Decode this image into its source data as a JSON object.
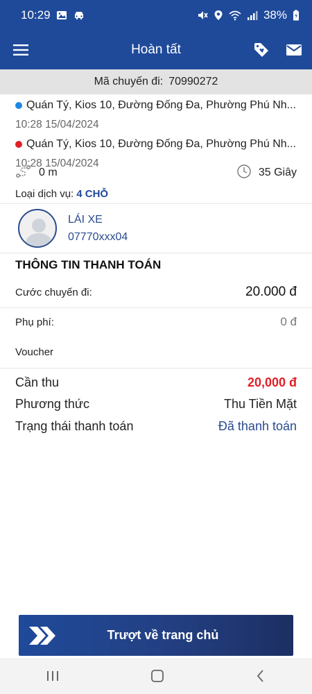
{
  "status_bar": {
    "time": "10:29",
    "battery": "38%",
    "icons_left": [
      "image-icon",
      "car-icon"
    ],
    "icons_right": [
      "mute-icon",
      "location-icon",
      "wifi-icon",
      "signal-icon",
      "battery-icon"
    ]
  },
  "app_bar": {
    "title": "Hoàn tất",
    "menu_icon": "hamburger-menu-icon",
    "actions": [
      "tag-heart-icon",
      "mail-icon"
    ]
  },
  "trip": {
    "id_label": "Mã chuyến đi:",
    "id_value": "70990272",
    "pickup": {
      "address": "Quán Tý, Kios 10, Đường Đống Đa, Phường Phú Nh...",
      "time": "10:28 15/04/2024",
      "color": "#1e88e5"
    },
    "dropoff": {
      "address": "Quán Tý, Kios 10, Đường Đống Đa, Phường Phú Nh...",
      "time": "10:28 15/04/2024",
      "color": "#e21f26"
    },
    "distance": "0 m",
    "duration": "35 Giây",
    "service_label": "Loại dịch vụ:",
    "service_value": "4 CHỖ"
  },
  "driver": {
    "title": "LÁI XE",
    "phone": "07770xxx04"
  },
  "payment": {
    "title": "THÔNG TIN THANH TOÁN",
    "fare_label": "Cước chuyến đi:",
    "fare_value": "20.000  đ",
    "fee_label": "Phụ phí:",
    "fee_value": "0 đ",
    "voucher_label": "Voucher",
    "due_label": "Cần thu",
    "due_value": "20,000 đ",
    "method_label": "Phương thức",
    "method_value": "Thu Tiền Mặt",
    "status_label": "Trạng thái thanh toán",
    "status_value": "Đã thanh toán"
  },
  "slide_button": {
    "label": "Trượt về trang chủ"
  },
  "colors": {
    "brand_blue": "#1f4a9a",
    "due_red": "#e21f26",
    "link_blue": "#2a4b8f"
  }
}
